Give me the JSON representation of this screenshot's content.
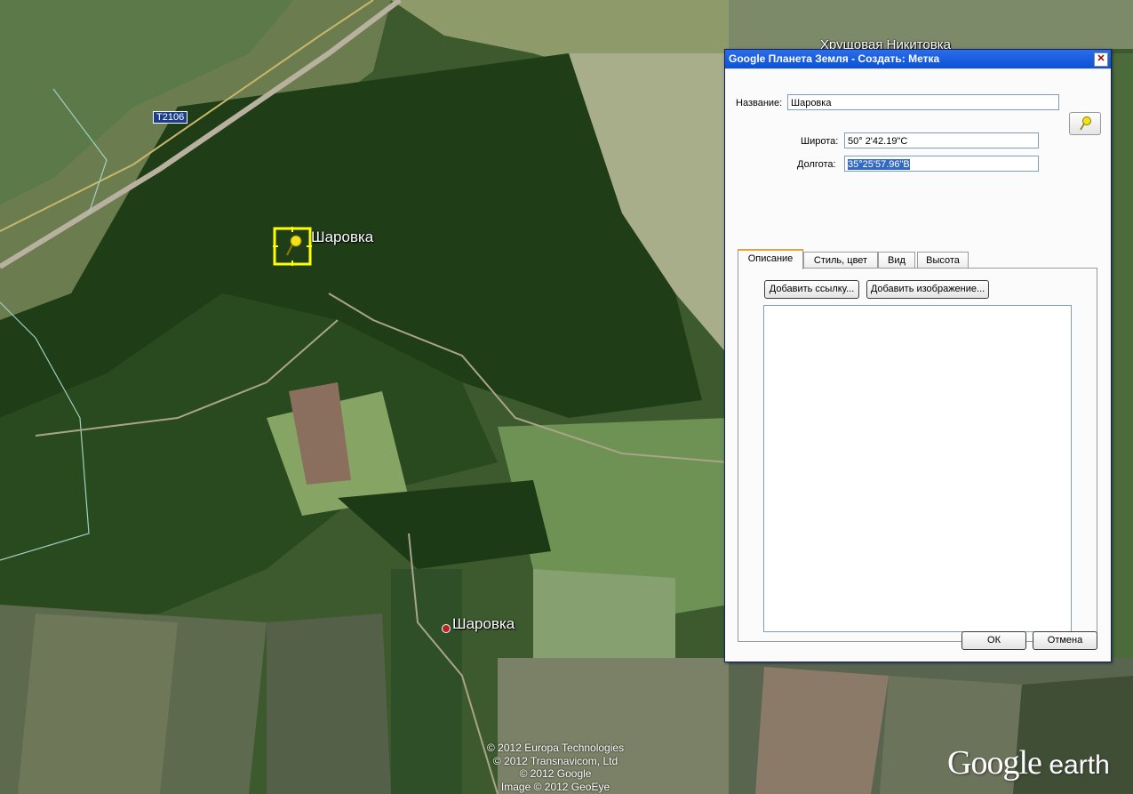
{
  "map": {
    "road_label": "T2106",
    "place_label_pin": "Шаровка",
    "place_label_village": "Шаровка",
    "place_label_top_cut": "Хрущовая Никитовка",
    "copyright_lines": [
      "© 2012 Europa Technologies",
      "© 2012 Transnavicom, Ltd",
      "© 2012 Google",
      "Image © 2012 GeoEye"
    ],
    "logo_main": "Google",
    "logo_suffix": "earth"
  },
  "dialog": {
    "title": "Google Планета Земля - Создать: Метка",
    "close_label": "✕",
    "name_label": "Название:",
    "name_value": "Шаровка",
    "lat_label": "Широта:",
    "lat_value": "50° 2'42.19\"С",
    "lon_label": "Долгота:",
    "lon_value": "35°25'57.96\"В",
    "tabs": [
      "Описание",
      "Стиль, цвет",
      "Вид",
      "Высота"
    ],
    "add_link_label": "Добавить ссылку...",
    "add_image_label": "Добавить изображение...",
    "description_value": "",
    "ok_label": "ОК",
    "cancel_label": "Отмена"
  },
  "colors": {
    "pin_highlight": "#ffff00",
    "titlebar": "#0a52d8",
    "active_tab_accent": "#f0a030",
    "selection": "#316ac5"
  }
}
